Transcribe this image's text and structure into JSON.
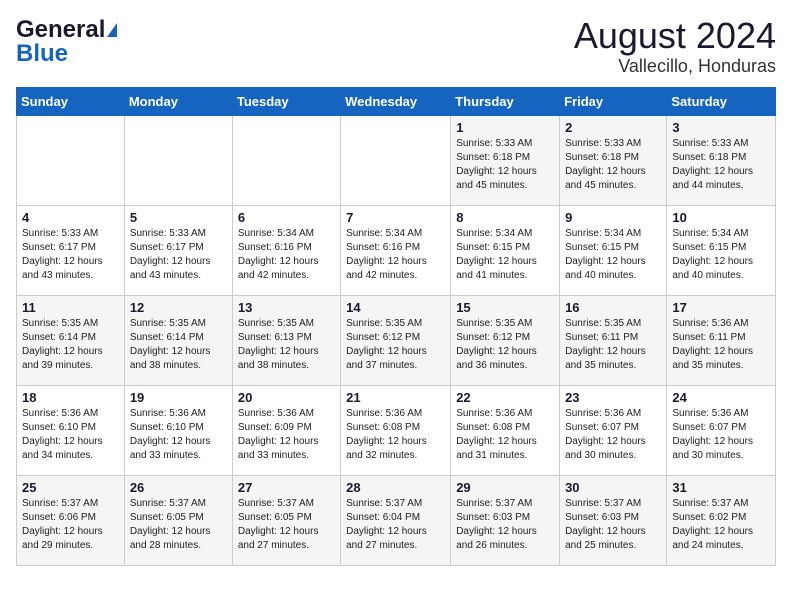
{
  "header": {
    "logo_general": "General",
    "logo_blue": "Blue",
    "title": "August 2024",
    "subtitle": "Vallecillo, Honduras"
  },
  "calendar": {
    "days_of_week": [
      "Sunday",
      "Monday",
      "Tuesday",
      "Wednesday",
      "Thursday",
      "Friday",
      "Saturday"
    ],
    "weeks": [
      [
        {
          "day": "",
          "info": ""
        },
        {
          "day": "",
          "info": ""
        },
        {
          "day": "",
          "info": ""
        },
        {
          "day": "",
          "info": ""
        },
        {
          "day": "1",
          "info": "Sunrise: 5:33 AM\nSunset: 6:18 PM\nDaylight: 12 hours\nand 45 minutes."
        },
        {
          "day": "2",
          "info": "Sunrise: 5:33 AM\nSunset: 6:18 PM\nDaylight: 12 hours\nand 45 minutes."
        },
        {
          "day": "3",
          "info": "Sunrise: 5:33 AM\nSunset: 6:18 PM\nDaylight: 12 hours\nand 44 minutes."
        }
      ],
      [
        {
          "day": "4",
          "info": "Sunrise: 5:33 AM\nSunset: 6:17 PM\nDaylight: 12 hours\nand 43 minutes."
        },
        {
          "day": "5",
          "info": "Sunrise: 5:33 AM\nSunset: 6:17 PM\nDaylight: 12 hours\nand 43 minutes."
        },
        {
          "day": "6",
          "info": "Sunrise: 5:34 AM\nSunset: 6:16 PM\nDaylight: 12 hours\nand 42 minutes."
        },
        {
          "day": "7",
          "info": "Sunrise: 5:34 AM\nSunset: 6:16 PM\nDaylight: 12 hours\nand 42 minutes."
        },
        {
          "day": "8",
          "info": "Sunrise: 5:34 AM\nSunset: 6:15 PM\nDaylight: 12 hours\nand 41 minutes."
        },
        {
          "day": "9",
          "info": "Sunrise: 5:34 AM\nSunset: 6:15 PM\nDaylight: 12 hours\nand 40 minutes."
        },
        {
          "day": "10",
          "info": "Sunrise: 5:34 AM\nSunset: 6:15 PM\nDaylight: 12 hours\nand 40 minutes."
        }
      ],
      [
        {
          "day": "11",
          "info": "Sunrise: 5:35 AM\nSunset: 6:14 PM\nDaylight: 12 hours\nand 39 minutes."
        },
        {
          "day": "12",
          "info": "Sunrise: 5:35 AM\nSunset: 6:14 PM\nDaylight: 12 hours\nand 38 minutes."
        },
        {
          "day": "13",
          "info": "Sunrise: 5:35 AM\nSunset: 6:13 PM\nDaylight: 12 hours\nand 38 minutes."
        },
        {
          "day": "14",
          "info": "Sunrise: 5:35 AM\nSunset: 6:12 PM\nDaylight: 12 hours\nand 37 minutes."
        },
        {
          "day": "15",
          "info": "Sunrise: 5:35 AM\nSunset: 6:12 PM\nDaylight: 12 hours\nand 36 minutes."
        },
        {
          "day": "16",
          "info": "Sunrise: 5:35 AM\nSunset: 6:11 PM\nDaylight: 12 hours\nand 35 minutes."
        },
        {
          "day": "17",
          "info": "Sunrise: 5:36 AM\nSunset: 6:11 PM\nDaylight: 12 hours\nand 35 minutes."
        }
      ],
      [
        {
          "day": "18",
          "info": "Sunrise: 5:36 AM\nSunset: 6:10 PM\nDaylight: 12 hours\nand 34 minutes."
        },
        {
          "day": "19",
          "info": "Sunrise: 5:36 AM\nSunset: 6:10 PM\nDaylight: 12 hours\nand 33 minutes."
        },
        {
          "day": "20",
          "info": "Sunrise: 5:36 AM\nSunset: 6:09 PM\nDaylight: 12 hours\nand 33 minutes."
        },
        {
          "day": "21",
          "info": "Sunrise: 5:36 AM\nSunset: 6:08 PM\nDaylight: 12 hours\nand 32 minutes."
        },
        {
          "day": "22",
          "info": "Sunrise: 5:36 AM\nSunset: 6:08 PM\nDaylight: 12 hours\nand 31 minutes."
        },
        {
          "day": "23",
          "info": "Sunrise: 5:36 AM\nSunset: 6:07 PM\nDaylight: 12 hours\nand 30 minutes."
        },
        {
          "day": "24",
          "info": "Sunrise: 5:36 AM\nSunset: 6:07 PM\nDaylight: 12 hours\nand 30 minutes."
        }
      ],
      [
        {
          "day": "25",
          "info": "Sunrise: 5:37 AM\nSunset: 6:06 PM\nDaylight: 12 hours\nand 29 minutes."
        },
        {
          "day": "26",
          "info": "Sunrise: 5:37 AM\nSunset: 6:05 PM\nDaylight: 12 hours\nand 28 minutes."
        },
        {
          "day": "27",
          "info": "Sunrise: 5:37 AM\nSunset: 6:05 PM\nDaylight: 12 hours\nand 27 minutes."
        },
        {
          "day": "28",
          "info": "Sunrise: 5:37 AM\nSunset: 6:04 PM\nDaylight: 12 hours\nand 27 minutes."
        },
        {
          "day": "29",
          "info": "Sunrise: 5:37 AM\nSunset: 6:03 PM\nDaylight: 12 hours\nand 26 minutes."
        },
        {
          "day": "30",
          "info": "Sunrise: 5:37 AM\nSunset: 6:03 PM\nDaylight: 12 hours\nand 25 minutes."
        },
        {
          "day": "31",
          "info": "Sunrise: 5:37 AM\nSunset: 6:02 PM\nDaylight: 12 hours\nand 24 minutes."
        }
      ]
    ]
  }
}
